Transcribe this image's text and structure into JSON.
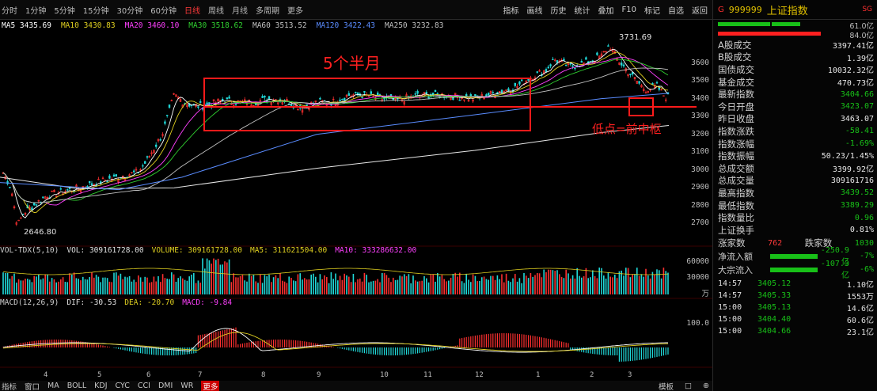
{
  "toolbar": {
    "left": [
      "分时",
      "1分钟",
      "5分钟",
      "15分钟",
      "30分钟",
      "60分钟",
      "日线",
      "周线",
      "月线",
      "多周期",
      "更多"
    ],
    "active_index": 6,
    "right": [
      "指标",
      "画线",
      "历史",
      "统计",
      "叠加",
      "F10",
      "标记",
      "自选",
      "返回"
    ]
  },
  "ma_legend": [
    {
      "label": "MA5",
      "value": "3435.69",
      "color": "#ffffff"
    },
    {
      "label": "MA10",
      "value": "3430.83",
      "color": "#e0d020"
    },
    {
      "label": "MA20",
      "value": "3460.10",
      "color": "#ff40ff"
    },
    {
      "label": "MA30",
      "value": "3518.62",
      "color": "#30d030"
    },
    {
      "label": "MA60",
      "value": "3513.52",
      "color": "#c0c0c0"
    },
    {
      "label": "MA120",
      "value": "3422.43",
      "color": "#5a8cff"
    },
    {
      "label": "MA250",
      "value": "3232.83",
      "color": "#c0c0c0"
    }
  ],
  "price_axis": [
    {
      "label": "3600",
      "price": 3600
    },
    {
      "label": "3500",
      "price": 3500
    },
    {
      "label": "3400",
      "price": 3400
    },
    {
      "label": "3300",
      "price": 3300
    },
    {
      "label": "3200",
      "price": 3200
    },
    {
      "label": "3100",
      "price": 3100
    },
    {
      "label": "3000",
      "price": 3000
    },
    {
      "label": "2900",
      "price": 2900
    },
    {
      "label": "2800",
      "price": 2800
    },
    {
      "label": "2700",
      "price": 2700
    }
  ],
  "annotations": {
    "high_label": "3731.69",
    "low_label": "2646.80",
    "box_text": "5个半月",
    "low_text": "低点=前中枢"
  },
  "volume_legend": {
    "title": "VOL-TDX(5,10)",
    "vol": "VOL: 309161728.00",
    "ma5": "VOLUME: 309161728.00",
    "ma5b": "MA5: 311621504.00",
    "ma10": "MA10: 333286632.00"
  },
  "vol_axis": [
    "60000",
    "30000",
    "万"
  ],
  "macd_legend": {
    "title": "MACD(12,26,9)",
    "dif": "DIF: -30.53",
    "dea": "DEA: -20.70",
    "macd": "MACD: -9.84"
  },
  "macd_axis": [
    "100.0"
  ],
  "month_labels": [
    "4",
    "5",
    "6",
    "7",
    "8",
    "9",
    "10",
    "11",
    "12",
    "1",
    "2",
    "3"
  ],
  "bottom_tabs": [
    "指标",
    "窗口",
    "MA",
    "BOLL",
    "KDJ",
    "CYC",
    "CCI",
    "DMI",
    "WR",
    "更多"
  ],
  "bottom_active": 9,
  "bottom_right": [
    "模板",
    "□",
    "⊕"
  ],
  "panel": {
    "code": "999999",
    "name": "上证指数",
    "tag": "G",
    "tag2": "SG",
    "ratio1": "61.0亿",
    "ratio2": "84.0亿",
    "rows": [
      {
        "label": "A股成交",
        "value": "3397.41亿",
        "cls": "w"
      },
      {
        "label": "B股成交",
        "value": "1.39亿",
        "cls": "w"
      },
      {
        "label": "国债成交",
        "value": "10032.32亿",
        "cls": "w"
      },
      {
        "label": "基金成交",
        "value": "470.73亿",
        "cls": "w"
      },
      {
        "label": "最新指数",
        "value": "3404.66",
        "cls": "gr"
      },
      {
        "label": "今日开盘",
        "value": "3423.07",
        "cls": "gr"
      },
      {
        "label": "昨日收盘",
        "value": "3463.07",
        "cls": "w"
      },
      {
        "label": "指数涨跌",
        "value": "-58.41",
        "cls": "gr"
      },
      {
        "label": "指数涨幅",
        "value": "-1.69%",
        "cls": "gr"
      },
      {
        "label": "指数振幅",
        "value": "50.23/1.45%",
        "cls": "w"
      },
      {
        "label": "总成交额",
        "value": "3399.92亿",
        "cls": "w"
      },
      {
        "label": "总成交量",
        "value": "309161716",
        "cls": "w"
      },
      {
        "label": "最高指数",
        "value": "3439.52",
        "cls": "gr"
      },
      {
        "label": "最低指数",
        "value": "3389.29",
        "cls": "gr"
      },
      {
        "label": "指数量比",
        "value": "0.96",
        "cls": "gr"
      },
      {
        "label": "上证换手",
        "value": "0.81%",
        "cls": "w"
      }
    ],
    "updown": {
      "up_label": "涨家数",
      "up": "762",
      "down_label": "跌家数",
      "down": "1030"
    },
    "flows": [
      {
        "label": "净流入额",
        "value": "-250.9亿",
        "pct": "-7%"
      },
      {
        "label": "大宗流入",
        "value": "-107.3亿",
        "pct": "-6%"
      }
    ],
    "ticks": [
      {
        "t": "14:57",
        "p": "3405.12",
        "v": "1.10亿"
      },
      {
        "t": "14:57",
        "p": "3405.33",
        "v": "1553万"
      },
      {
        "t": "15:00",
        "p": "3405.13",
        "v": "14.6亿"
      },
      {
        "t": "15:00",
        "p": "3404.40",
        "v": "60.6亿"
      },
      {
        "t": "15:00",
        "p": "3404.66",
        "v": "23.1亿"
      }
    ]
  }
}
